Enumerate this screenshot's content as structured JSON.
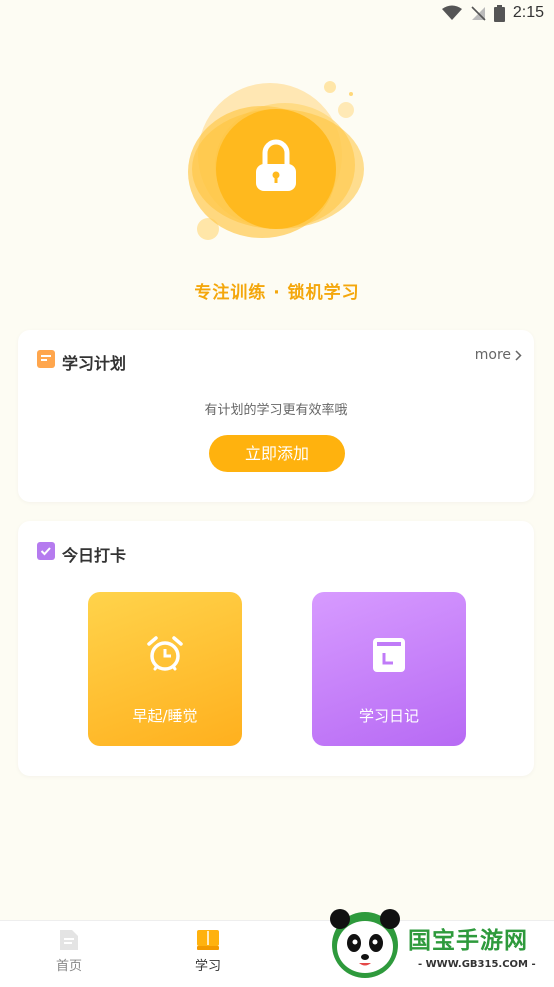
{
  "status_bar": {
    "time": "2:15"
  },
  "hero": {
    "tagline": "专注训练 · 锁机学习",
    "icon": "lock-icon"
  },
  "plan_card": {
    "title": "学习计划",
    "more_label": "more",
    "empty_text": "有计划的学习更有效率哦",
    "add_button": "立即添加"
  },
  "checkin_card": {
    "title": "今日打卡",
    "tiles": [
      {
        "label": "早起/睡觉",
        "icon": "alarm-clock-icon"
      },
      {
        "label": "学习日记",
        "icon": "calendar-icon"
      }
    ]
  },
  "bottom_nav": {
    "items": [
      {
        "label": "首页",
        "icon": "home-document-icon"
      },
      {
        "label": "学习",
        "icon": "book-icon"
      }
    ]
  },
  "watermark": {
    "text": "国宝手游网",
    "url": "- WWW.GB315.COM -"
  },
  "colors": {
    "accent": "#FFB20E",
    "purple": "#B76AF4",
    "background": "#FDFCF3"
  }
}
